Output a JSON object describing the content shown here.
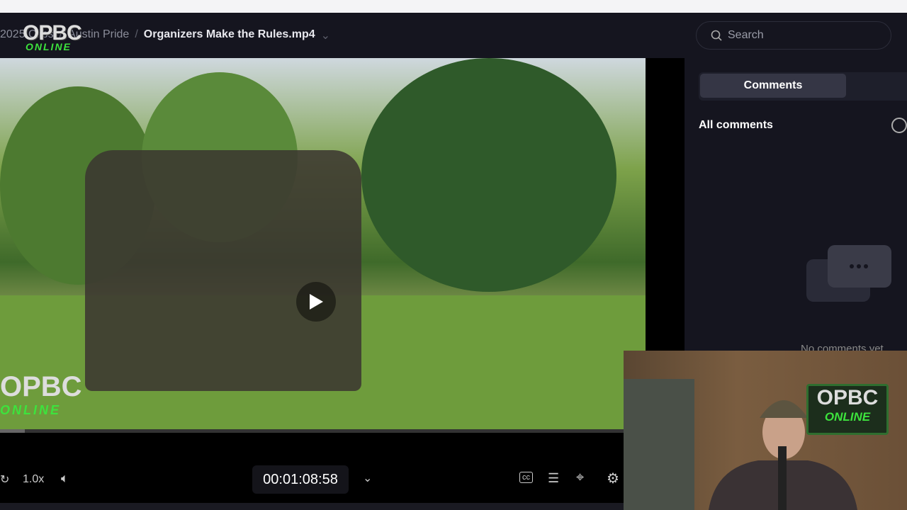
{
  "header": {
    "breadcrumbs": [
      "2025 Clips",
      "Austin Pride"
    ],
    "current_file": "Organizers Make the Rules.mp4",
    "logo": {
      "line1": "OPBC",
      "line2": "ONLINE"
    },
    "search_placeholder": "Search"
  },
  "player": {
    "speed": "1.0x",
    "timecode": "00:01:08:58",
    "progress_percent": 4,
    "watermark": {
      "line1": "OPBC",
      "line2": "ONLINE"
    }
  },
  "sidebar": {
    "tab": "Comments",
    "section_title": "All comments",
    "empty_text": "No comments yet"
  },
  "webcam": {
    "logo": {
      "line1": "OPBC",
      "line2": "ONLINE"
    }
  },
  "colors": {
    "header_bg": "#15151f",
    "accent_green": "#3de33d"
  }
}
